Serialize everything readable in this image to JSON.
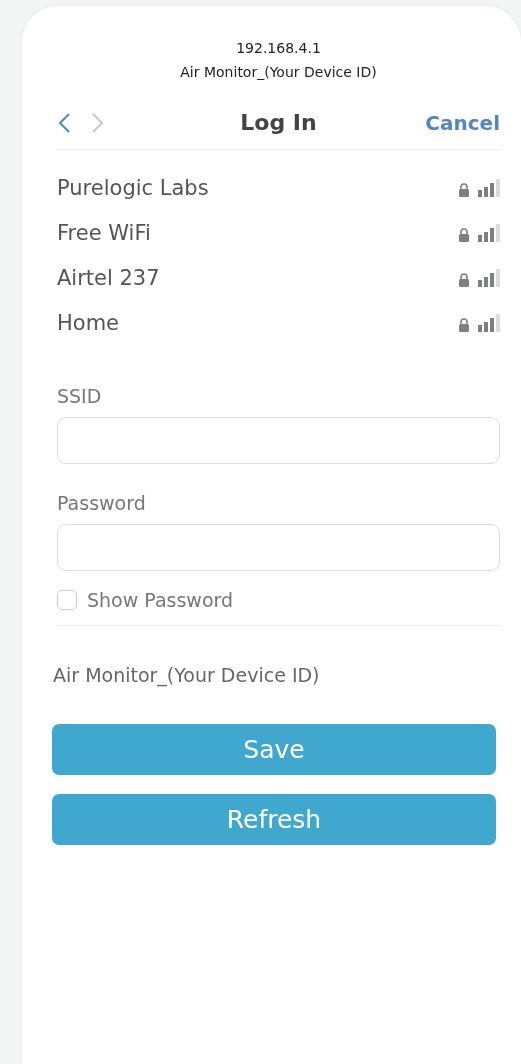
{
  "header": {
    "address": "192.168.4.1",
    "device": "Air Monitor_(Your Device ID)"
  },
  "nav": {
    "back_enabled": true,
    "forward_enabled": false,
    "title": "Log In",
    "cancel": "Cancel"
  },
  "networks": [
    {
      "name": "Purelogic Labs",
      "locked": true
    },
    {
      "name": "Free WiFi",
      "locked": true
    },
    {
      "name": "Airtel 237",
      "locked": true
    },
    {
      "name": "Home",
      "locked": true
    }
  ],
  "form": {
    "ssid_label": "SSID",
    "password_label": "Password",
    "show_password": {
      "label": "Show Password",
      "checked": false
    }
  },
  "device_name": "Air Monitor_(Your Device ID)",
  "buttons": [
    "Save",
    "Refresh"
  ]
}
